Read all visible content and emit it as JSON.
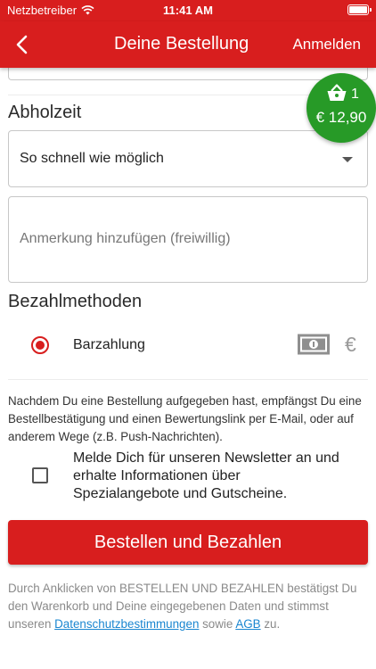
{
  "status_bar": {
    "carrier": "Netzbetreiber",
    "time": "11:41 AM"
  },
  "nav": {
    "title": "Deine Bestellung",
    "login": "Anmelden"
  },
  "pickup": {
    "title": "Abholzeit",
    "selected": "So schnell wie möglich"
  },
  "note": {
    "placeholder": "Anmerkung hinzufügen (freiwillig)"
  },
  "payment": {
    "title": "Bezahlmethoden",
    "option_label": "Barzahlung",
    "selected": true,
    "currency_symbol": "€"
  },
  "info_text": "Nachdem Du eine Bestellung aufgegeben hast, empfängst Du eine Bestellbestätigung und einen Bewertungslink per E-Mail, oder auf anderem Wege (z.B. Push-Nachrichten).",
  "newsletter": {
    "checked": false,
    "text": "Melde Dich für unseren Newsletter an und erhalte Informationen über Spezialangebote und Gutscheine."
  },
  "order_button": "Bestellen und Bezahlen",
  "legal": {
    "prefix": "Durch Anklicken von BESTELLEN UND BEZAHLEN bestätigst Du den Warenkorb und Deine eingegebenen Daten und stimmst unseren ",
    "privacy_link": "Datenschutzbestimmungen",
    "middle": " sowie ",
    "terms_link": "AGB",
    "suffix": " zu."
  },
  "cart": {
    "count": "1",
    "total": "€ 12,90",
    "icon": "basket-icon"
  },
  "colors": {
    "primary": "#d81e1e",
    "cart": "#279a27",
    "link": "#1a86d0"
  }
}
